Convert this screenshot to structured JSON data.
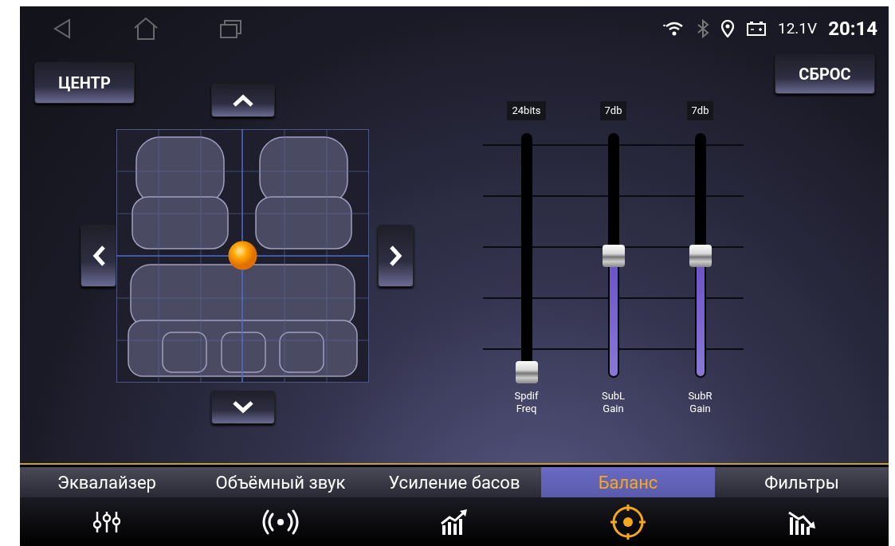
{
  "status_bar": {
    "voltage": "12.1V",
    "time": "20:14"
  },
  "center_button": "ЦЕНТР",
  "reset_button": "СБРОС",
  "sliders": [
    {
      "value": "24bits",
      "label": "Spdif\nFreq",
      "level": 0
    },
    {
      "value": "7db",
      "label": "SubL\nGain",
      "level": 0.5
    },
    {
      "value": "7db",
      "label": "SubR\nGain",
      "level": 0.5
    }
  ],
  "tabs": [
    {
      "label": "Эквалайзер",
      "kind": "equalizer",
      "selected": false
    },
    {
      "label": "Объёмный звук",
      "kind": "surround",
      "selected": false
    },
    {
      "label": "Усиление басов",
      "kind": "bass",
      "selected": false
    },
    {
      "label": "Баланс",
      "kind": "balance",
      "selected": true
    },
    {
      "label": "Фильтры",
      "kind": "filters",
      "selected": false
    }
  ]
}
